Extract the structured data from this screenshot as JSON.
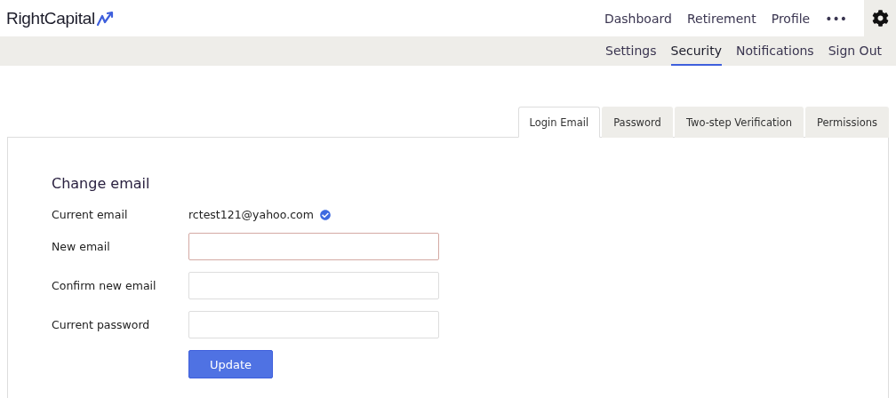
{
  "logo": {
    "text": "RightCapital"
  },
  "top_nav": [
    {
      "label": "Dashboard"
    },
    {
      "label": "Retirement"
    },
    {
      "label": "Profile"
    },
    {
      "label": "•••"
    }
  ],
  "sub_nav": [
    {
      "label": "Settings",
      "selected": false
    },
    {
      "label": "Security",
      "selected": true
    },
    {
      "label": "Notifications",
      "selected": false
    },
    {
      "label": "Sign Out",
      "selected": false
    }
  ],
  "tabs": [
    {
      "label": "Login Email",
      "selected": true
    },
    {
      "label": "Password",
      "selected": false
    },
    {
      "label": "Two-step Verification",
      "selected": false
    },
    {
      "label": "Permissions",
      "selected": false
    }
  ],
  "form": {
    "title": "Change email",
    "current_email": {
      "label": "Current email",
      "value": "rctest121@yahoo.com",
      "verified": true
    },
    "fields": [
      {
        "label": "New email",
        "invalid": true
      },
      {
        "label": "Confirm new email",
        "invalid": false
      },
      {
        "label": "Current password",
        "invalid": false
      }
    ],
    "submit": "Update"
  }
}
